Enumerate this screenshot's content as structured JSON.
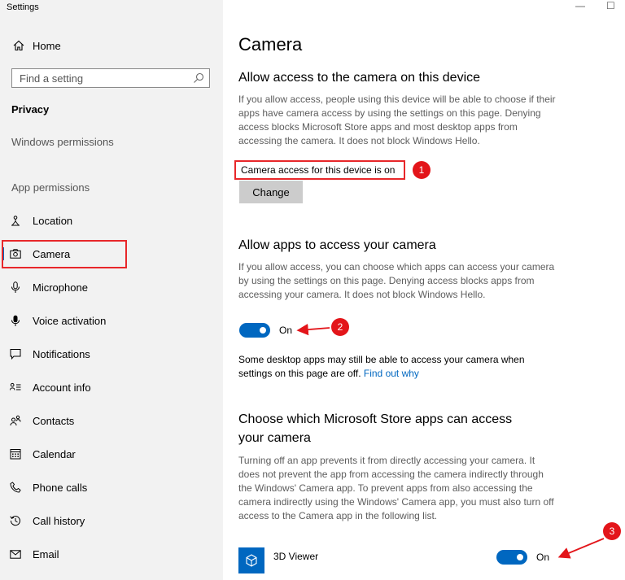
{
  "window": {
    "title": "Settings",
    "minimize_glyph": "—",
    "maximize_glyph": "☐"
  },
  "sidebar": {
    "home_label": "Home",
    "search_placeholder": "Find a setting",
    "section_title": "Privacy",
    "windows_permissions": "Windows permissions",
    "app_permissions": "App permissions",
    "items": [
      {
        "label": "Location",
        "icon": "location-icon"
      },
      {
        "label": "Camera",
        "icon": "camera-icon",
        "selected": true
      },
      {
        "label": "Microphone",
        "icon": "microphone-icon"
      },
      {
        "label": "Voice activation",
        "icon": "voice-activation-icon"
      },
      {
        "label": "Notifications",
        "icon": "notifications-icon"
      },
      {
        "label": "Account info",
        "icon": "account-info-icon"
      },
      {
        "label": "Contacts",
        "icon": "contacts-icon"
      },
      {
        "label": "Calendar",
        "icon": "calendar-icon"
      },
      {
        "label": "Phone calls",
        "icon": "phone-calls-icon"
      },
      {
        "label": "Call history",
        "icon": "call-history-icon"
      },
      {
        "label": "Email",
        "icon": "email-icon"
      }
    ]
  },
  "main": {
    "title": "Camera",
    "device_section": {
      "heading": "Allow access to the camera on this device",
      "description": "If you allow access, people using this device will be able to choose if their apps have camera access by using the settings on this page. Denying access blocks Microsoft Store apps and most desktop apps from accessing the camera. It does not block Windows Hello.",
      "status": "Camera access for this device is on",
      "change_button": "Change"
    },
    "apps_section": {
      "heading": "Allow apps to access your camera",
      "description": "If you allow access, you can choose which apps can access your camera by using the settings on this page. Denying access blocks apps from accessing your camera. It does not block Windows Hello.",
      "toggle_state": "On",
      "note": "Some desktop apps may still be able to access your camera when settings on this page are off.",
      "note_link": "Find out why"
    },
    "store_section": {
      "heading_line1": "Choose which Microsoft Store apps can access",
      "heading_line2": "your camera",
      "description": "Turning off an app prevents it from directly accessing your camera. It does not prevent the app from accessing the camera indirectly through the Windows' Camera app. To prevent apps from also accessing the camera indirectly using the Windows' Camera app, you must also turn off access to the Camera app in the following list.",
      "apps": [
        {
          "name": "3D Viewer",
          "toggle_state": "On",
          "icon": "3d-viewer-icon"
        }
      ]
    }
  },
  "annotations": {
    "badge_1": "1",
    "badge_2": "2",
    "badge_3": "3",
    "color": "#e3151a"
  },
  "colors": {
    "accent": "#0067c0",
    "sidebar_bg": "#f2f2f2",
    "highlight": "#e8272a"
  }
}
